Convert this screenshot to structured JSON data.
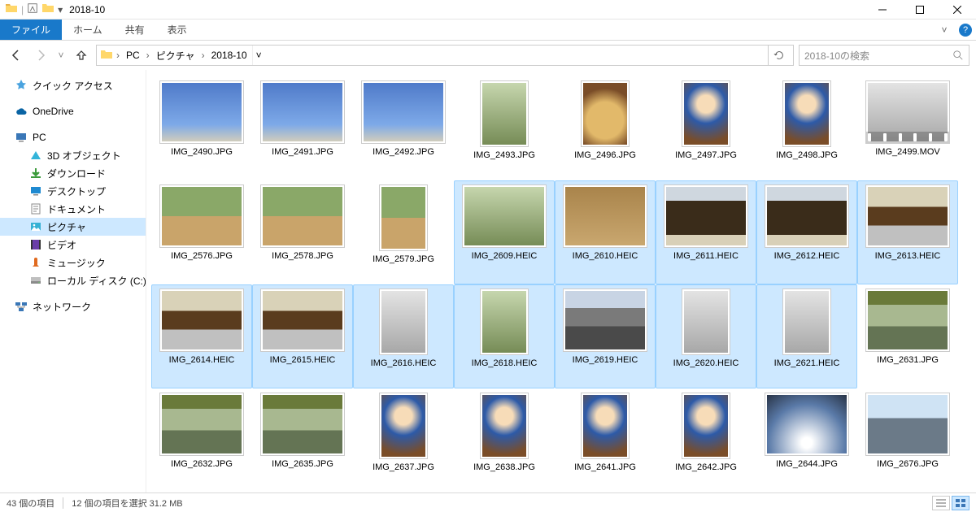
{
  "window": {
    "title": "2018-10"
  },
  "ribbon": {
    "file": "ファイル",
    "tabs": [
      "ホーム",
      "共有",
      "表示"
    ]
  },
  "breadcrumbs": [
    "PC",
    "ピクチャ",
    "2018-10"
  ],
  "search": {
    "placeholder": "2018-10の検索"
  },
  "sidebar": {
    "quick_access": "クイック アクセス",
    "onedrive": "OneDrive",
    "pc": "PC",
    "pc_children": [
      "3D オブジェクト",
      "ダウンロード",
      "デスクトップ",
      "ドキュメント",
      "ピクチャ",
      "ビデオ",
      "ミュージック",
      "ローカル ディスク (C:)"
    ],
    "network": "ネットワーク",
    "selected_index": 4
  },
  "files": [
    {
      "name": "IMG_2490.JPG",
      "cls": "p-sky",
      "portrait": false,
      "sel": false,
      "video": false
    },
    {
      "name": "IMG_2491.JPG",
      "cls": "p-sky",
      "portrait": false,
      "sel": false,
      "video": false
    },
    {
      "name": "IMG_2492.JPG",
      "cls": "p-sky",
      "portrait": false,
      "sel": false,
      "video": false
    },
    {
      "name": "IMG_2493.JPG",
      "cls": "p-park",
      "portrait": true,
      "sel": false,
      "video": false
    },
    {
      "name": "IMG_2496.JPG",
      "cls": "p-food",
      "portrait": true,
      "sel": false,
      "video": false
    },
    {
      "name": "IMG_2497.JPG",
      "cls": "p-kid",
      "portrait": true,
      "sel": false,
      "video": false
    },
    {
      "name": "IMG_2498.JPG",
      "cls": "p-kid",
      "portrait": true,
      "sel": false,
      "video": false
    },
    {
      "name": "IMG_2499.MOV",
      "cls": "p-stone",
      "portrait": false,
      "sel": false,
      "video": true
    },
    {
      "name": "IMG_2576.JPG",
      "cls": "p-horse",
      "portrait": false,
      "sel": false,
      "video": false
    },
    {
      "name": "IMG_2578.JPG",
      "cls": "p-horse",
      "portrait": false,
      "sel": false,
      "video": false
    },
    {
      "name": "IMG_2579.JPG",
      "cls": "p-horse",
      "portrait": true,
      "sel": false,
      "video": false
    },
    {
      "name": "IMG_2609.HEIC",
      "cls": "p-park",
      "portrait": false,
      "sel": true,
      "video": false
    },
    {
      "name": "IMG_2610.HEIC",
      "cls": "p-board",
      "portrait": false,
      "sel": true,
      "video": false
    },
    {
      "name": "IMG_2611.HEIC",
      "cls": "p-gate",
      "portrait": false,
      "sel": true,
      "video": false
    },
    {
      "name": "IMG_2612.HEIC",
      "cls": "p-gate",
      "portrait": false,
      "sel": true,
      "video": false
    },
    {
      "name": "IMG_2613.HEIC",
      "cls": "p-temple",
      "portrait": false,
      "sel": true,
      "video": false
    },
    {
      "name": "IMG_2614.HEIC",
      "cls": "p-temple",
      "portrait": false,
      "sel": true,
      "video": false
    },
    {
      "name": "IMG_2615.HEIC",
      "cls": "p-temple",
      "portrait": false,
      "sel": true,
      "video": false
    },
    {
      "name": "IMG_2616.HEIC",
      "cls": "p-stone",
      "portrait": true,
      "sel": true,
      "video": false
    },
    {
      "name": "IMG_2618.HEIC",
      "cls": "p-park",
      "portrait": true,
      "sel": true,
      "video": false
    },
    {
      "name": "IMG_2619.HEIC",
      "cls": "p-street",
      "portrait": false,
      "sel": true,
      "video": false
    },
    {
      "name": "IMG_2620.HEIC",
      "cls": "p-stone",
      "portrait": true,
      "sel": true,
      "video": false
    },
    {
      "name": "IMG_2621.HEIC",
      "cls": "p-stone",
      "portrait": true,
      "sel": true,
      "video": false
    },
    {
      "name": "IMG_2631.JPG",
      "cls": "p-stream",
      "portrait": false,
      "sel": false,
      "video": false
    },
    {
      "name": "IMG_2632.JPG",
      "cls": "p-stream",
      "portrait": false,
      "sel": false,
      "video": false
    },
    {
      "name": "IMG_2635.JPG",
      "cls": "p-stream",
      "portrait": false,
      "sel": false,
      "video": false
    },
    {
      "name": "IMG_2637.JPG",
      "cls": "p-kid",
      "portrait": true,
      "sel": false,
      "video": false
    },
    {
      "name": "IMG_2638.JPG",
      "cls": "p-kid",
      "portrait": true,
      "sel": false,
      "video": false
    },
    {
      "name": "IMG_2641.JPG",
      "cls": "p-kid",
      "portrait": true,
      "sel": false,
      "video": false
    },
    {
      "name": "IMG_2642.JPG",
      "cls": "p-kid",
      "portrait": true,
      "sel": false,
      "video": false
    },
    {
      "name": "IMG_2644.JPG",
      "cls": "p-skyray",
      "portrait": false,
      "sel": false,
      "video": false
    },
    {
      "name": "IMG_2676.JPG",
      "cls": "p-city",
      "portrait": false,
      "sel": false,
      "video": false
    }
  ],
  "status": {
    "count_label": "43 個の項目",
    "selection_label": "12 個の項目を選択 31.2 MB"
  }
}
